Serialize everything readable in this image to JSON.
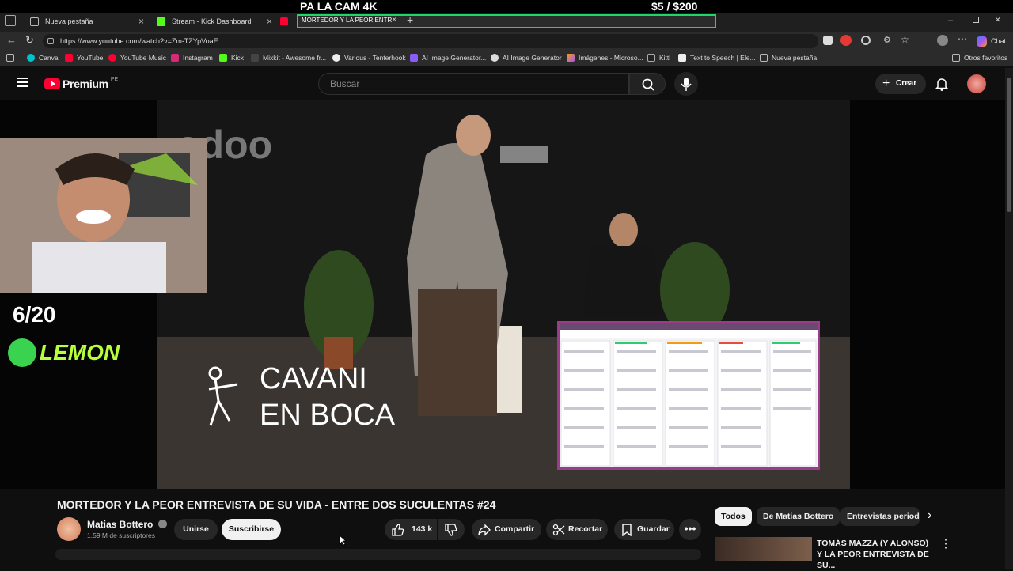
{
  "overlay": {
    "left_text": "PA LA CAM 4K",
    "right_text": "$5  / $200"
  },
  "tabs": [
    {
      "label": "Nueva pestaña"
    },
    {
      "label": "Stream - Kick Dashboard"
    },
    {
      "label": "MORTEDOR Y LA PEOR ENTR"
    }
  ],
  "address": {
    "url": "https://www.youtube.com/watch?v=Zm-TZYpVoaE"
  },
  "bookmarks": [
    "Canva",
    "YouTube",
    "YouTube Music",
    "Instagram",
    "Kick",
    "Mixkit - Awesome fr...",
    "Various - Tenterhook",
    "AI Image Generator...",
    "AI Image Generator",
    "Imágenes - Microso...",
    "Kittl",
    "Text to Speech | Ele...",
    "Nueva pestaña"
  ],
  "bookmarks_other": "Otros favoritos",
  "browser_chat": "Chat",
  "youtube": {
    "logo": "Premium",
    "region": "PE",
    "search_placeholder": "Buscar",
    "create_label": "Crear"
  },
  "video": {
    "overlay_counter": "6/20",
    "overlay_brand": "LEMON",
    "sponsor_logo": "odoo",
    "caption_line1": "CAVANI",
    "caption_line2": "EN BOCA"
  },
  "meta": {
    "title": "MORTEDOR Y LA PEOR ENTREVISTA DE SU VIDA - ENTRE DOS SUCULENTAS #24",
    "channel": "Matias Bottero",
    "subscribers": "1.59 M de suscriptores",
    "join_label": "Unirse",
    "subscribe_label": "Suscribirse",
    "likes": "143 k",
    "share_label": "Compartir",
    "clip_label": "Recortar",
    "save_label": "Guardar"
  },
  "chips": [
    "Todos",
    "De Matias Bottero",
    "Entrevistas periodís"
  ],
  "recommendation": {
    "title": "TOMÁS MAZZA (Y ALONSO) Y LA PEOR ENTREVISTA DE SU..."
  },
  "colors": {
    "youtube_red": "#ff0033",
    "kick_green": "#53fc18",
    "active_tab_border": "#1fd66a"
  }
}
